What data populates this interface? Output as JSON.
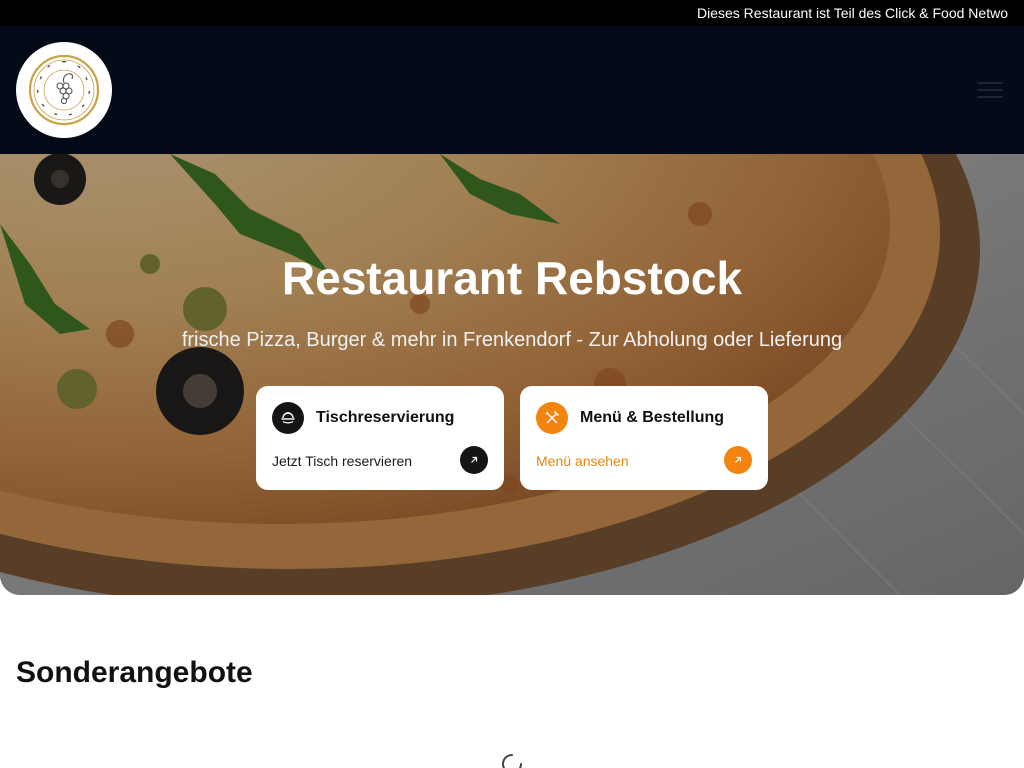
{
  "announcement": {
    "text": "Dieses Restaurant ist Teil des Click & Food Netwo"
  },
  "header": {
    "logo": {
      "alt": "Restaurant Rebstock Logo",
      "text": "RESTAURANT • REBSTOCK"
    },
    "menu_icon": "hamburger-menu-icon"
  },
  "hero": {
    "title": "Restaurant Rebstock",
    "subtitle": "frische Pizza, Burger & mehr in Frenkendorf - Zur Abholung oder Lieferung",
    "cards": [
      {
        "icon": "table-reservation-icon",
        "title": "Tischreservierung",
        "link_text": "Jetzt Tisch reservieren",
        "arrow_icon": "arrow-up-right-icon"
      },
      {
        "icon": "cutlery-icon",
        "title": "Menü & Bestellung",
        "link_text": "Menü ansehen",
        "arrow_icon": "arrow-up-right-icon"
      }
    ]
  },
  "offers": {
    "heading": "Sonderangebote",
    "loading_icon": "loading-spinner-icon"
  },
  "colors": {
    "accent": "#f3840f",
    "header_bg": "#040a17",
    "announcement_bg": "#000000",
    "dark_button": "#141414"
  }
}
